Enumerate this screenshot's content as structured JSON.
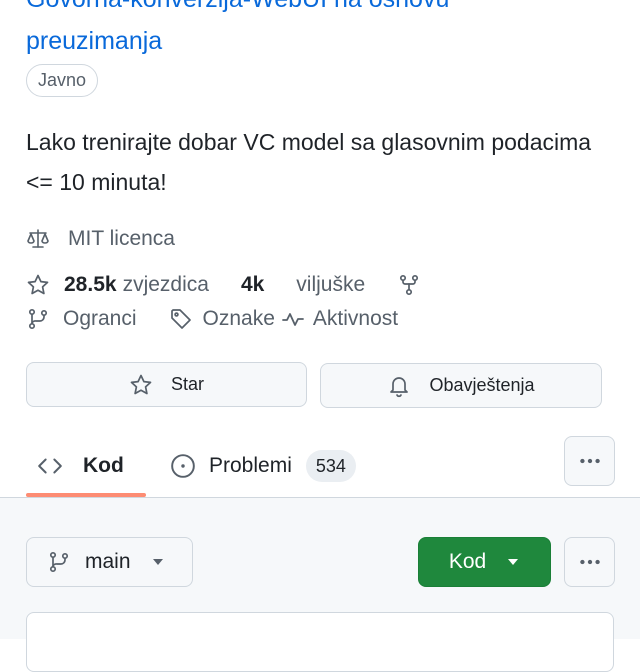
{
  "repo": {
    "title_line1": "Govorna-konverzija-WebUI na osnovu",
    "title_line2": "preuzimanja",
    "visibility": "Javno",
    "description": "Lako trenirajte dobar VC model sa glasovnim podacima <= 10 minuta!"
  },
  "meta": {
    "license": "MIT licenca",
    "stars_count": "28.5k",
    "stars_label": "zvjezdica",
    "forks_count": "4k",
    "forks_label": "viljuške",
    "branches_label": "Ogranci",
    "tags_label": "Oznake",
    "activity_label": "Aktivnost"
  },
  "actions": {
    "star_label": "Star",
    "notifications_label": "Obavještenja"
  },
  "tabs": {
    "code_label": "Kod",
    "issues_label": "Problemi",
    "issues_count": "534"
  },
  "toolbar": {
    "branch_name": "main",
    "code_button_label": "Kod"
  },
  "colors": {
    "link": "#0969da",
    "accent_underline": "#fd8c73",
    "primary_button": "#1f883d"
  },
  "icons": {
    "license": "law-icon",
    "star": "star-icon",
    "fork": "fork-icon",
    "branch": "branch-icon",
    "tag": "tag-icon",
    "activity": "pulse-icon",
    "bell": "bell-icon",
    "code": "code-icon",
    "issue": "issue-opened-icon",
    "more": "kebab-horizontal-icon",
    "caret": "triangle-down-icon"
  }
}
